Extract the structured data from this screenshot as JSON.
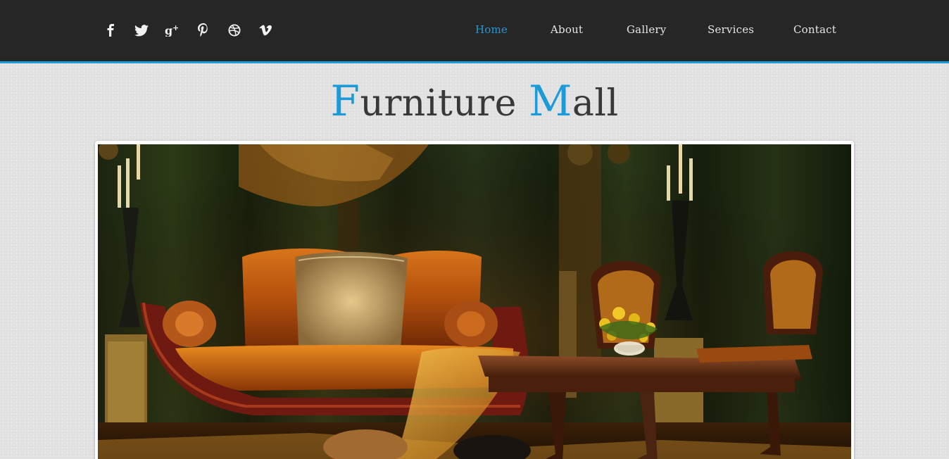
{
  "header": {
    "social": [
      {
        "name": "facebook-icon",
        "label": "Facebook"
      },
      {
        "name": "twitter-icon",
        "label": "Twitter"
      },
      {
        "name": "google-plus-icon",
        "label": "Google Plus"
      },
      {
        "name": "pinterest-icon",
        "label": "Pinterest"
      },
      {
        "name": "dribbble-icon",
        "label": "Dribbble"
      },
      {
        "name": "vimeo-icon",
        "label": "Vimeo"
      }
    ],
    "nav": [
      {
        "label": "Home",
        "active": true
      },
      {
        "label": "About",
        "active": false
      },
      {
        "label": "Gallery",
        "active": false
      },
      {
        "label": "Services",
        "active": false
      },
      {
        "label": "Contact",
        "active": false
      }
    ]
  },
  "brand": {
    "first_initial": "F",
    "first_rest": "urniture",
    "second_initial": "M",
    "second_rest": "all"
  },
  "hero": {
    "alt": "Luxury living room with orange velvet sofa, cushions, coffee table and flowers"
  },
  "colors": {
    "accent": "#1e9ad6",
    "header_bg": "#262626",
    "page_bg": "#e3e3e3",
    "title_text": "#383838"
  }
}
